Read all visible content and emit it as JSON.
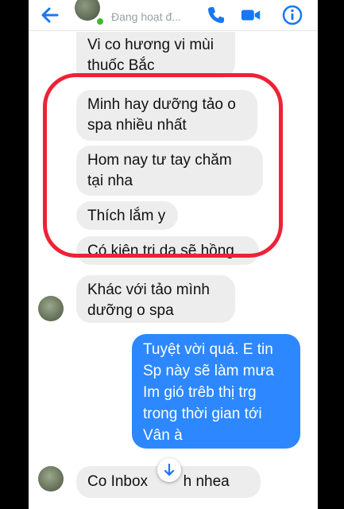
{
  "header": {
    "status": "Đang hoạt đ...",
    "colors": {
      "accent": "#1877f2",
      "online": "#42b72a"
    },
    "icons": [
      "back-arrow-icon",
      "phone-icon",
      "video-camera-icon",
      "info-icon"
    ]
  },
  "messages": {
    "m1": {
      "line1": "Vi co hương vi mùi",
      "line2": "thuốc Bắc"
    },
    "m2": {
      "line1": "Minh hay dưỡng tảo o",
      "line2": "spa nhiều nhất"
    },
    "m3": {
      "line1": "Hom nay tư tay chăm",
      "line2": "tại nha"
    },
    "m4": {
      "line1": "Thích lắm y"
    },
    "m5": {
      "line1": "Có kiên tri da sẽ hồng"
    },
    "m6": {
      "line1": "Khác với tảo mình",
      "line2": "dưỡng o spa"
    },
    "sent": {
      "line1": "Tuyệt vời quá. E tin",
      "line2": "Sp này sẽ làm mưa",
      "line3": "Im gió trêb thị trg",
      "line4": "trong thời gian tới",
      "line5": "Vân à"
    },
    "m7": {
      "line1": "Co Inbox",
      "line2": "h nhea"
    }
  },
  "colors": {
    "sent_bubble": "#2d88ff",
    "received_bubble": "#ededed",
    "highlight": "#ee2236"
  }
}
